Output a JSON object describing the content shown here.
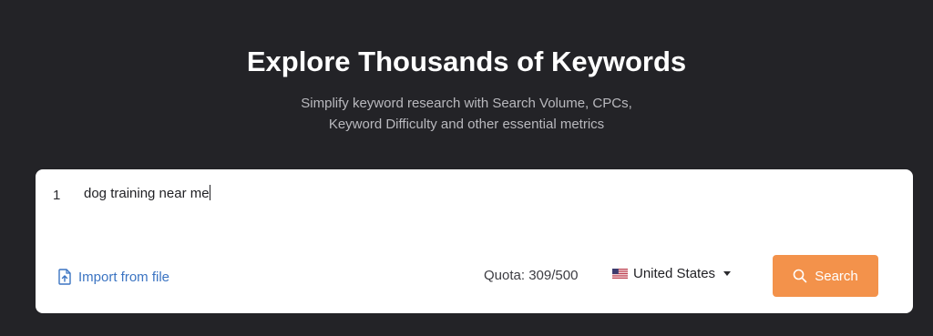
{
  "header": {
    "title": "Explore Thousands of Keywords",
    "subtitle_line1": "Simplify keyword research with Search Volume, CPCs,",
    "subtitle_line2": "Keyword Difficulty and other essential metrics"
  },
  "editor": {
    "line_number": "1",
    "keyword": "dog training near me"
  },
  "footer": {
    "import_label": "Import from file",
    "quota_text": "Quota: 309/500",
    "country": "United States",
    "search_label": "Search"
  },
  "icons": {
    "import": "file-upload-icon",
    "flag": "us-flag-icon",
    "dropdown": "chevron-down-icon",
    "search": "search-icon"
  },
  "colors": {
    "background": "#232327",
    "accent": "#f3924b",
    "link": "#3b74c2"
  }
}
